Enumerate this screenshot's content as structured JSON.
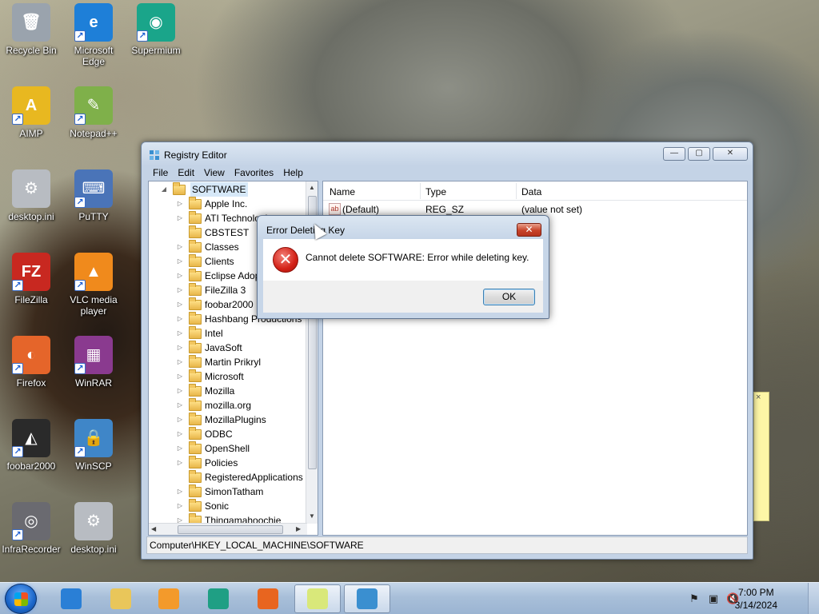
{
  "desktop": {
    "icons": [
      {
        "label": "Recycle Bin",
        "symbol": "🗑"
      },
      {
        "label": "Microsoft Edge",
        "symbol": "e"
      },
      {
        "label": "Supermium",
        "symbol": "◉"
      },
      {
        "label": "AIMP",
        "symbol": "A"
      },
      {
        "label": "Notepad++",
        "symbol": "✎"
      },
      {
        "label": "desktop.ini",
        "symbol": "⚙"
      },
      {
        "label": "PuTTY",
        "symbol": "⌨"
      },
      {
        "label": "FileZilla",
        "symbol": "FZ"
      },
      {
        "label": "VLC media player",
        "symbol": "▲"
      },
      {
        "label": "Firefox",
        "symbol": "◐"
      },
      {
        "label": "WinRAR",
        "symbol": "▦"
      },
      {
        "label": "foobar2000",
        "symbol": "◭"
      },
      {
        "label": "WinSCP",
        "symbol": "🔒"
      },
      {
        "label": "InfraRecorder",
        "symbol": "◎"
      },
      {
        "label": "desktop.ini",
        "symbol": "⚙"
      }
    ]
  },
  "registry_editor": {
    "title": "Registry Editor",
    "controls": {
      "minimize": "—",
      "maximize": "▢",
      "close": "✕"
    },
    "menu": [
      "File",
      "Edit",
      "View",
      "Favorites",
      "Help"
    ],
    "tree": {
      "root": "SOFTWARE",
      "items": [
        "Apple Inc.",
        "ATI Technologies",
        "CBSTEST",
        "Classes",
        "Clients",
        "Eclipse Adoptium",
        "FileZilla 3",
        "foobar2000",
        "Hashbang Productions",
        "Intel",
        "JavaSoft",
        "Martin Prikryl",
        "Microsoft",
        "Mozilla",
        "mozilla.org",
        "MozillaPlugins",
        "ODBC",
        "OpenShell",
        "Policies",
        "RegisteredApplications",
        "SimonTatham",
        "Sonic",
        "Thingamahoochie"
      ],
      "expandable": [
        true,
        true,
        false,
        true,
        true,
        true,
        true,
        true,
        true,
        true,
        true,
        true,
        true,
        true,
        true,
        true,
        true,
        true,
        true,
        false,
        true,
        true,
        true
      ]
    },
    "list": {
      "columns": [
        "Name",
        "Type",
        "Data"
      ],
      "rows": [
        {
          "name": "(Default)",
          "type": "REG_SZ",
          "data": "(value not set)"
        }
      ]
    },
    "status": "Computer\\HKEY_LOCAL_MACHINE\\SOFTWARE"
  },
  "dialog": {
    "title": "Error Deleting Key",
    "message": "Cannot delete SOFTWARE:  Error while deleting key.",
    "ok_label": "OK",
    "close_glyph": "✕",
    "error_glyph": "✕"
  },
  "taskbar": {
    "items": [
      {
        "name": "internet-explorer",
        "color": "#2a7fd6",
        "active": false
      },
      {
        "name": "file-explorer",
        "color": "#e9c65a",
        "active": false
      },
      {
        "name": "windows-media-player",
        "color": "#f39a2b",
        "active": false
      },
      {
        "name": "supermium",
        "color": "#1f9f84",
        "active": false
      },
      {
        "name": "firefox",
        "color": "#e8651f",
        "active": false
      },
      {
        "name": "sticky-notes",
        "color": "#d9e87a",
        "active": true
      },
      {
        "name": "registry-editor",
        "color": "#3a8fd0",
        "active": true
      }
    ],
    "tray": [
      "⚑",
      "▣",
      "🔇"
    ],
    "time": "7:00 PM",
    "date": "3/14/2024"
  },
  "sticky_note": {
    "close_glyph": "×"
  }
}
